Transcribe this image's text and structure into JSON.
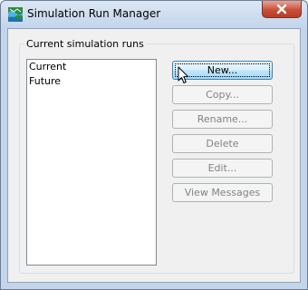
{
  "window": {
    "title": "Simulation Run Manager",
    "app_icon": "hec-hms-icon",
    "close_icon": "close-icon"
  },
  "group": {
    "label": "Current simulation runs"
  },
  "runs": [
    "Current",
    "Future"
  ],
  "buttons": {
    "new": "New...",
    "copy": "Copy...",
    "rename": "Rename...",
    "delete": "Delete",
    "edit": "Edit...",
    "view_messages": "View Messages"
  },
  "colors": {
    "frame": "#c4d5ea",
    "close_button": "#c9503a",
    "active_button_border": "#3c7fb1"
  }
}
